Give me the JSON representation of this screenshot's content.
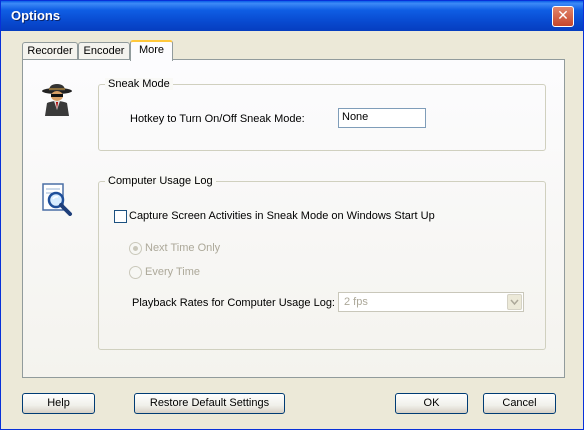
{
  "window": {
    "title": "Options",
    "close_glyph": "✕"
  },
  "tabs": [
    {
      "label": "Recorder",
      "active": false
    },
    {
      "label": "Encoder",
      "active": false
    },
    {
      "label": "More",
      "active": true
    }
  ],
  "sneak_mode": {
    "group_title": "Sneak Mode",
    "icon": "spy-icon",
    "hotkey_label": "Hotkey to Turn On/Off Sneak Mode:",
    "hotkey_value": "None"
  },
  "usage_log": {
    "group_title": "Computer Usage Log",
    "icon": "magnifier-document-icon",
    "capture_label": "Capture Screen Activities in Sneak Mode on Windows Start Up",
    "capture_checked": false,
    "radio_next_time": "Next Time Only",
    "radio_next_time_selected": true,
    "radio_every_time": "Every Time",
    "playback_label": "Playback Rates for Computer Usage Log:",
    "playback_value": "2 fps"
  },
  "buttons": {
    "help": "Help",
    "restore": "Restore Default Settings",
    "ok": "OK",
    "cancel": "Cancel"
  },
  "colors": {
    "titlebar": "#0a5fe8",
    "face": "#ece9d8",
    "disabled_text": "#aca899",
    "tab_highlight": "#ffc83c"
  }
}
